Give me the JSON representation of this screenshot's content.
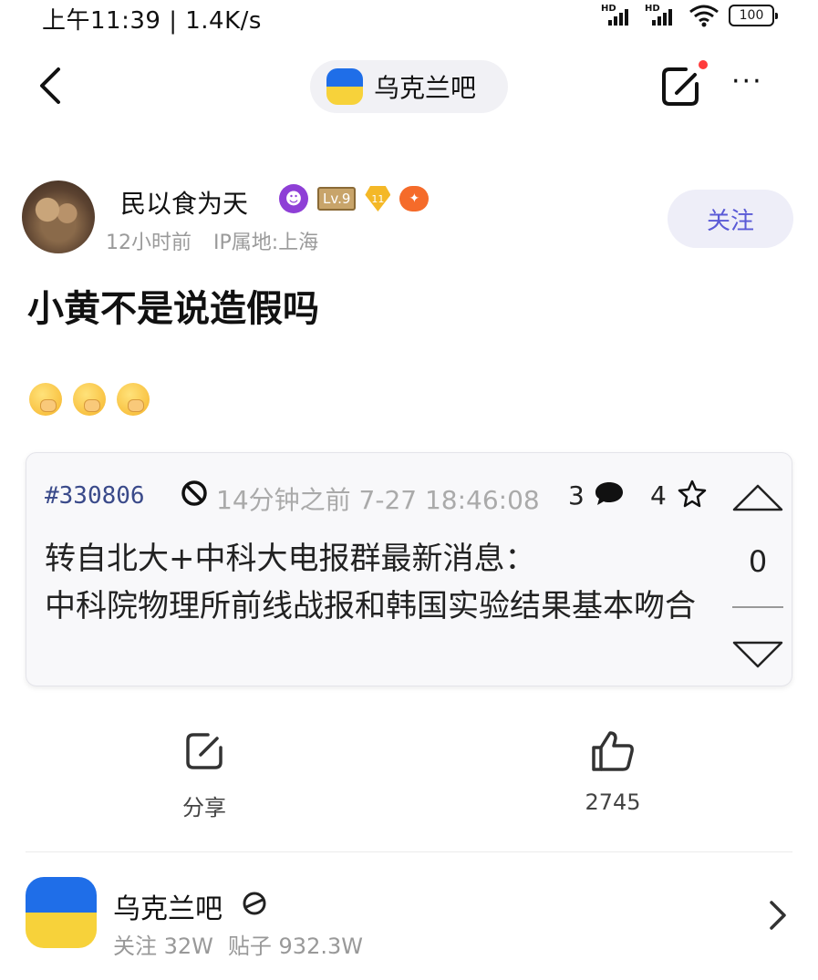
{
  "status_bar": {
    "time": "上午11:39 | 1.4K/s",
    "hd_label": "HD",
    "battery": "100"
  },
  "nav": {
    "forum_name": "乌克兰吧",
    "more": "···"
  },
  "post": {
    "author": {
      "name": "民以食为天",
      "level": "Lv.9",
      "diamond_level": "11",
      "time": "12小时前",
      "ip": "IP属地:上海",
      "follow_label": "关注"
    },
    "title": "小黄不是说造假吗",
    "emojis": [
      "face-with-hand-over-mouth",
      "face-with-hand-over-mouth",
      "face-with-hand-over-mouth"
    ]
  },
  "quote": {
    "id": "#330806",
    "time": "14分钟之前 7-27 18:46:08",
    "replies": "3",
    "stars": "4",
    "text": "转自北大+中科大电报群最新消息：\n中科院物理所前线战报和韩国实验结果基本吻合",
    "votes": "0"
  },
  "actions": {
    "share_label": "分享",
    "like_count": "2745"
  },
  "forum_card": {
    "name": "乌克兰吧",
    "followers": "关注 32W",
    "posts": "贴子 932.3W"
  },
  "colors": {
    "flag_blue": "#1f6ee8",
    "flag_yellow": "#f7d23a",
    "follow_text": "#5a5ad6",
    "follow_bg": "#eeeef8",
    "notify_dot": "#ff3b3b"
  }
}
